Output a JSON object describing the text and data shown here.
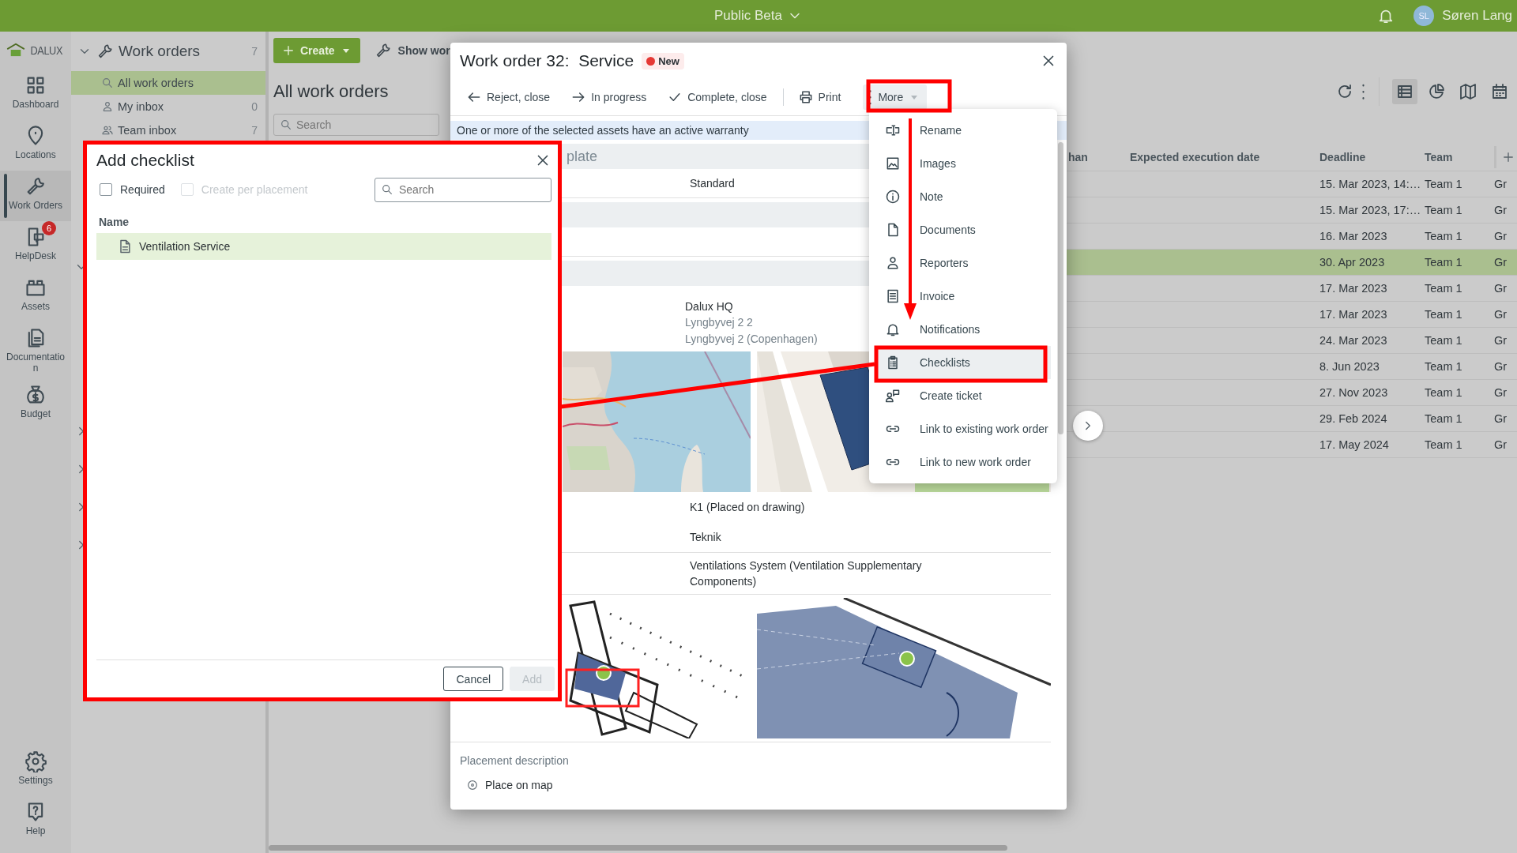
{
  "top_bar": {
    "title": "Public Beta",
    "initials": "SL",
    "user": "Søren Lang"
  },
  "nav_rail": {
    "logo": "DALUX",
    "items": [
      {
        "label": "Dashboard",
        "selected": false
      },
      {
        "label": "Locations",
        "selected": false
      },
      {
        "label": "Work Orders",
        "selected": true
      },
      {
        "label": "HelpDesk",
        "selected": false,
        "badge": "6"
      },
      {
        "label": "Assets",
        "selected": false
      },
      {
        "label": "Documentation",
        "selected": false
      },
      {
        "label": "Budget",
        "selected": false
      }
    ],
    "bottom_items": [
      {
        "label": "Settings"
      },
      {
        "label": "Help"
      }
    ]
  },
  "tree": {
    "title": "Work orders",
    "count": "7",
    "items": [
      {
        "label": "All work orders",
        "selected": true
      },
      {
        "label": "My inbox",
        "count": "0",
        "selected": false
      },
      {
        "label": "Team inbox",
        "count": "7",
        "selected": false
      }
    ],
    "groups": [
      {
        "expanded": true
      },
      {
        "expanded": false
      },
      {
        "expanded": false
      },
      {
        "expanded": false
      },
      {
        "expanded": false
      }
    ]
  },
  "list": {
    "create": "Create",
    "show": "Show wor",
    "heading": "All work orders",
    "search_placeholder": "Search",
    "views": [
      {
        "selected": true
      },
      {
        "selected": false
      },
      {
        "selected": false
      },
      {
        "selected": false
      }
    ]
  },
  "table": {
    "columns": [
      "han",
      "Expected execution date",
      "Deadline",
      "Team"
    ],
    "rows": [
      {
        "deadline": "15. Mar 2023, 14:…",
        "team": "Team 1",
        "column_5": "Gr",
        "selected": false
      },
      {
        "deadline": "15. Mar 2023, 17:…",
        "team": "Team 1",
        "column_5": "Gr",
        "selected": false
      },
      {
        "deadline": "16. Mar 2023",
        "team": "Team 1",
        "column_5": "Gr",
        "selected": false
      },
      {
        "deadline": "30. Apr 2023",
        "team": "Team 1",
        "column_5": "Gr",
        "selected": true
      },
      {
        "deadline": "17. Mar 2023",
        "team": "Team 1",
        "column_5": "Gr",
        "selected": false
      },
      {
        "deadline": "17. Mar 2023",
        "team": "Team 1",
        "column_5": "Gr",
        "selected": false
      },
      {
        "deadline": "24. Mar 2023",
        "team": "Team 1",
        "column_5": "Gr",
        "selected": false
      },
      {
        "deadline": "8. Jun 2023",
        "team": "Team 1",
        "column_5": "Gr",
        "selected": false
      },
      {
        "deadline": "27. Nov 2023",
        "team": "Team 1",
        "column_5": "Gr",
        "selected": false
      },
      {
        "deadline": "29. Feb 2024",
        "team": "Team 1",
        "column_5": "Gr",
        "selected": false
      },
      {
        "deadline": "17. May 2024",
        "team": "Team 1",
        "column_5": "Gr",
        "selected": false
      }
    ]
  },
  "work_order": {
    "title": "Work order 32:",
    "name": "Service",
    "status": "New",
    "actions": [
      {
        "label": "Reject, close"
      },
      {
        "label": "In progress"
      },
      {
        "label": "Complete, close"
      },
      {
        "label": "Print"
      },
      {
        "label": "More"
      }
    ],
    "notice": "One or more of the selected assets have an active warranty",
    "section_title": "plate",
    "template": "Standard",
    "location": {
      "name": "Dalux HQ",
      "lines": [
        "Lyngbyvej 2 2",
        "Lyngbyvej 2 (Copenhagen)"
      ]
    },
    "placement": "K1 (Placed on drawing)",
    "room": "Teknik",
    "asset": "Ventilations System (Ventilation Supplementary Components)",
    "placement_description": "Placement description",
    "place_on_map": "Place on map"
  },
  "more_menu": {
    "items": [
      {
        "label": "Rename",
        "selected": false
      },
      {
        "label": "Images",
        "selected": false
      },
      {
        "label": "Note",
        "selected": false
      },
      {
        "label": "Documents",
        "selected": false
      },
      {
        "label": "Reporters",
        "selected": false
      },
      {
        "label": "Invoice",
        "selected": false
      },
      {
        "label": "Notifications",
        "selected": false
      },
      {
        "label": "Checklists",
        "selected": true
      },
      {
        "label": "Create ticket",
        "selected": false
      },
      {
        "label": "Link to existing work order",
        "selected": false
      },
      {
        "label": "Link to new work order",
        "selected": false
      }
    ]
  },
  "add_checklist": {
    "title": "Add checklist",
    "options": [
      {
        "label": "Required",
        "checked": false,
        "disabled": false
      },
      {
        "label": "Create per placement",
        "checked": false,
        "disabled": true
      }
    ],
    "search_placeholder": "Search",
    "column": "Name",
    "rows": [
      {
        "label": "Ventilation Service",
        "selected": true
      }
    ],
    "buttons": [
      {
        "label": "Cancel",
        "disabled": false
      },
      {
        "label": "Add",
        "disabled": true
      }
    ]
  }
}
